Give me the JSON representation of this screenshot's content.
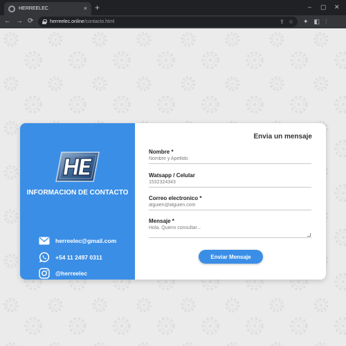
{
  "browser": {
    "tab_title": "HERREELEC",
    "tab_close": "×",
    "new_tab": "+",
    "window_controls": [
      "–",
      "▢",
      "✕"
    ],
    "nav": {
      "back": "←",
      "forward": "→",
      "reload": "⟳"
    },
    "url_host": "herreelec.online",
    "url_path": "/contacto.html",
    "omnibox_icons": [
      "⇪",
      "☆"
    ],
    "toolbar_icons": [
      "✦",
      "◧",
      "⫶"
    ]
  },
  "contact_card": {
    "logo_text": "HE",
    "title": "INFORMACION DE CONTACTO",
    "email": "herreelec@gmail.com",
    "phone": "+54 11 2497 0311",
    "instagram": "@herreelec",
    "icons": [
      "envelope-icon",
      "whatsapp-icon",
      "instagram-icon"
    ]
  },
  "form": {
    "title": "Envia un mensaje",
    "fields": [
      {
        "label": "Nombre *",
        "placeholder": "Nombre y Apellido"
      },
      {
        "label": "Watsapp / Celular",
        "placeholder": "1532324343"
      },
      {
        "label": "Correo electronico *",
        "placeholder": "alguien@alguien.com"
      },
      {
        "label": "Mensaje *",
        "placeholder": "Hola. Quiero consultar..."
      }
    ],
    "submit_label": "Enviar Mensaje"
  },
  "colors": {
    "accent": "#3a8ee6",
    "page_bg": "#ebebeb",
    "card_bg": "#ffffff",
    "chrome_dark": "#202124",
    "chrome_toolbar": "#35363a"
  }
}
